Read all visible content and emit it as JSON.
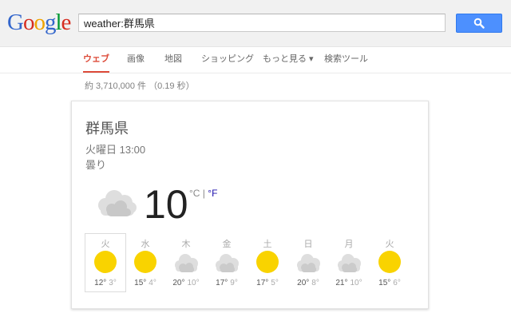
{
  "search": {
    "query": "weather:群馬県"
  },
  "logo": {
    "text": "Google"
  },
  "nav": {
    "items": [
      {
        "label": "ウェブ",
        "active": true
      },
      {
        "label": "画像"
      },
      {
        "label": "地図"
      },
      {
        "label": "ショッピング"
      },
      {
        "label": "もっと見る ▾"
      },
      {
        "label": "検索ツール"
      }
    ]
  },
  "stats": {
    "text": "約 3,710,000 件 （0.19 秒）"
  },
  "weather": {
    "location": "群馬県",
    "datetime": "火曜日 13:00",
    "condition": "曇り",
    "temperature": "10",
    "unit_c": "°C",
    "unit_sep": " | ",
    "unit_f": "°F",
    "current_icon": "cloudy-icon",
    "forecast": [
      {
        "day": "火",
        "icon": "sunny-icon",
        "hi": "12°",
        "lo": "3°"
      },
      {
        "day": "水",
        "icon": "sunny-icon",
        "hi": "15°",
        "lo": "4°"
      },
      {
        "day": "木",
        "icon": "cloudy-icon",
        "hi": "20°",
        "lo": "10°"
      },
      {
        "day": "金",
        "icon": "cloudy-icon",
        "hi": "17°",
        "lo": "9°"
      },
      {
        "day": "土",
        "icon": "sunny-icon",
        "hi": "17°",
        "lo": "5°"
      },
      {
        "day": "日",
        "icon": "cloudy-icon",
        "hi": "20°",
        "lo": "8°"
      },
      {
        "day": "月",
        "icon": "cloudy-icon",
        "hi": "21°",
        "lo": "10°"
      },
      {
        "day": "火",
        "icon": "sunny-icon",
        "hi": "15°",
        "lo": "6°"
      }
    ]
  },
  "colors": {
    "accent": "#dd4b39",
    "search_button": "#4d90fe",
    "sun": "#f9d300",
    "cloud": "#dcdcdc",
    "link": "#1a0dab"
  }
}
